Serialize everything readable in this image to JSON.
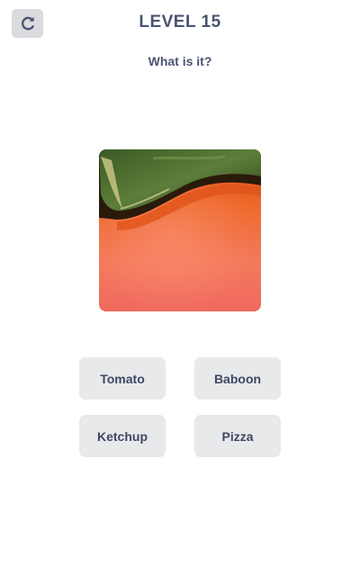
{
  "header": {
    "level_title": "LEVEL 15",
    "restart_icon": "restart-icon"
  },
  "question": {
    "text": "What is it?"
  },
  "picture": {
    "subject": "tomato-closeup",
    "colors": {
      "fruit_top": "#e65420",
      "fruit_bottom": "#f2786a",
      "leaf": "#4a6a2e"
    }
  },
  "answers": [
    {
      "label": "Tomato"
    },
    {
      "label": "Baboon"
    },
    {
      "label": "Ketchup"
    },
    {
      "label": "Pizza"
    }
  ],
  "colors": {
    "text": "#4a5470",
    "button_bg": "#e8e9eb",
    "restart_bg": "#dadbde"
  }
}
